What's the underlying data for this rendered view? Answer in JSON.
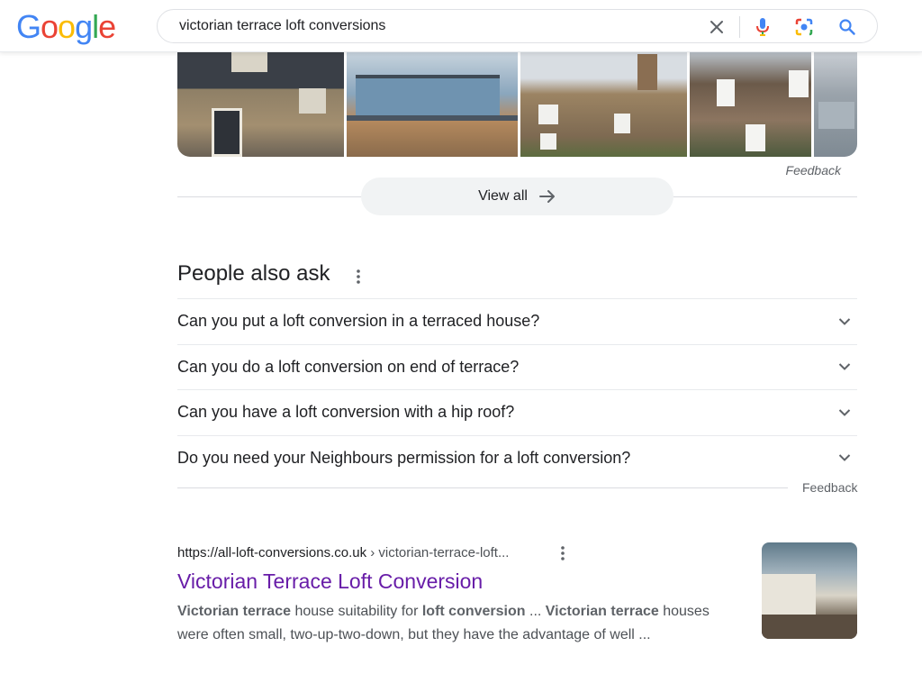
{
  "header": {
    "logo_letters": [
      {
        "ch": "G",
        "color": "#4285F4"
      },
      {
        "ch": "o",
        "color": "#EA4335"
      },
      {
        "ch": "o",
        "color": "#FBBC05"
      },
      {
        "ch": "g",
        "color": "#4285F4"
      },
      {
        "ch": "l",
        "color": "#34A853"
      },
      {
        "ch": "e",
        "color": "#EA4335"
      }
    ],
    "search_query": "victorian terrace loft conversions",
    "icons": [
      "close-icon",
      "microphone-icon",
      "camera-lens-icon",
      "search-icon"
    ]
  },
  "images_panel": {
    "feedback_label": "Feedback",
    "view_all_label": "View all"
  },
  "people_also_ask": {
    "title": "People also ask",
    "questions": [
      "Can you put a loft conversion in a terraced house?",
      "Can you do a loft conversion on end of terrace?",
      "Can you have a loft conversion with a hip roof?",
      "Do you need your Neighbours permission for a loft conversion?"
    ],
    "feedback_label": "Feedback"
  },
  "result": {
    "url": "https://all-loft-conversions.co.uk",
    "breadcrumb": " › victorian-terrace-loft...",
    "title": "Victorian Terrace Loft Conversion",
    "snippet_parts": [
      {
        "text": "Victorian terrace",
        "bold": true
      },
      {
        "text": " house suitability for ",
        "bold": false
      },
      {
        "text": "loft conversion",
        "bold": true
      },
      {
        "text": " ... ",
        "bold": false
      },
      {
        "text": "Victorian terrace",
        "bold": true
      },
      {
        "text": " houses were often small, two-up-two-down, but they have the advantage of well ...",
        "bold": false
      }
    ]
  },
  "colors": {
    "visited_link": "#681da8",
    "mic_blue": "#4285F4",
    "search_blue": "#4285F4"
  }
}
